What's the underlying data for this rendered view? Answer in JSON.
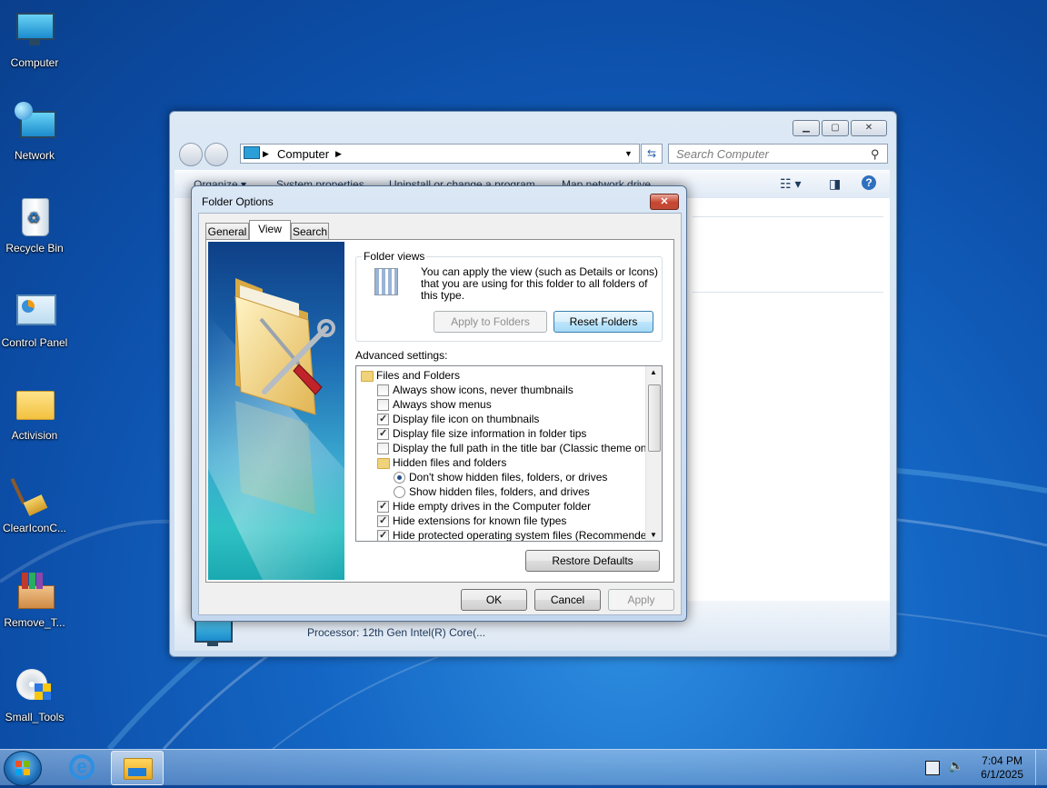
{
  "desktop": {
    "icons": [
      {
        "label": "Computer",
        "icon": "computer-icon"
      },
      {
        "label": "Network",
        "icon": "network-icon"
      },
      {
        "label": "Recycle Bin",
        "icon": "recycle-bin-icon"
      },
      {
        "label": "Control Panel",
        "icon": "control-panel-icon"
      },
      {
        "label": "Activision",
        "icon": "folder-icon"
      },
      {
        "label": "ClearIconC...",
        "icon": "broom-icon"
      },
      {
        "label": "Remove_T...",
        "icon": "archive-box-icon"
      },
      {
        "label": "Small_Tools",
        "icon": "cd-installer-icon"
      }
    ]
  },
  "explorer": {
    "address": "Computer",
    "search_placeholder": "Search Computer",
    "commands": [
      "Organize ▾",
      "System properties",
      "Uninstall or change a program",
      "Map network drive"
    ],
    "details": "Processor: 12th Gen Intel(R) Core(..."
  },
  "dialog": {
    "title": "Folder Options",
    "tabs": [
      "General",
      "View",
      "Search"
    ],
    "active_tab": "View",
    "folder_views": {
      "legend": "Folder views",
      "text": "You can apply the view (such as Details or Icons) that you are using for this folder to all folders of this type.",
      "apply_label": "Apply to Folders",
      "reset_label": "Reset Folders"
    },
    "advanced_label": "Advanced settings:",
    "settings": [
      {
        "type": "folder",
        "label": "Files and Folders",
        "indent": 0
      },
      {
        "type": "checkbox",
        "label": "Always show icons, never thumbnails",
        "checked": false,
        "indent": 1
      },
      {
        "type": "checkbox",
        "label": "Always show menus",
        "checked": false,
        "indent": 1
      },
      {
        "type": "checkbox",
        "label": "Display file icon on thumbnails",
        "checked": true,
        "indent": 1
      },
      {
        "type": "checkbox",
        "label": "Display file size information in folder tips",
        "checked": true,
        "indent": 1
      },
      {
        "type": "checkbox",
        "label": "Display the full path in the title bar (Classic theme only)",
        "checked": false,
        "indent": 1
      },
      {
        "type": "folder",
        "label": "Hidden files and folders",
        "indent": 1
      },
      {
        "type": "radio",
        "label": "Don't show hidden files, folders, or drives",
        "checked": true,
        "indent": 2
      },
      {
        "type": "radio",
        "label": "Show hidden files, folders, and drives",
        "checked": false,
        "indent": 2
      },
      {
        "type": "checkbox",
        "label": "Hide empty drives in the Computer folder",
        "checked": true,
        "indent": 1
      },
      {
        "type": "checkbox",
        "label": "Hide extensions for known file types",
        "checked": true,
        "indent": 1
      },
      {
        "type": "checkbox",
        "label": "Hide protected operating system files (Recommended)",
        "checked": true,
        "indent": 1
      }
    ],
    "restore_label": "Restore Defaults",
    "ok_label": "OK",
    "cancel_label": "Cancel",
    "apply_label": "Apply"
  },
  "taskbar": {
    "time": "7:04 PM",
    "date": "6/1/2025"
  }
}
